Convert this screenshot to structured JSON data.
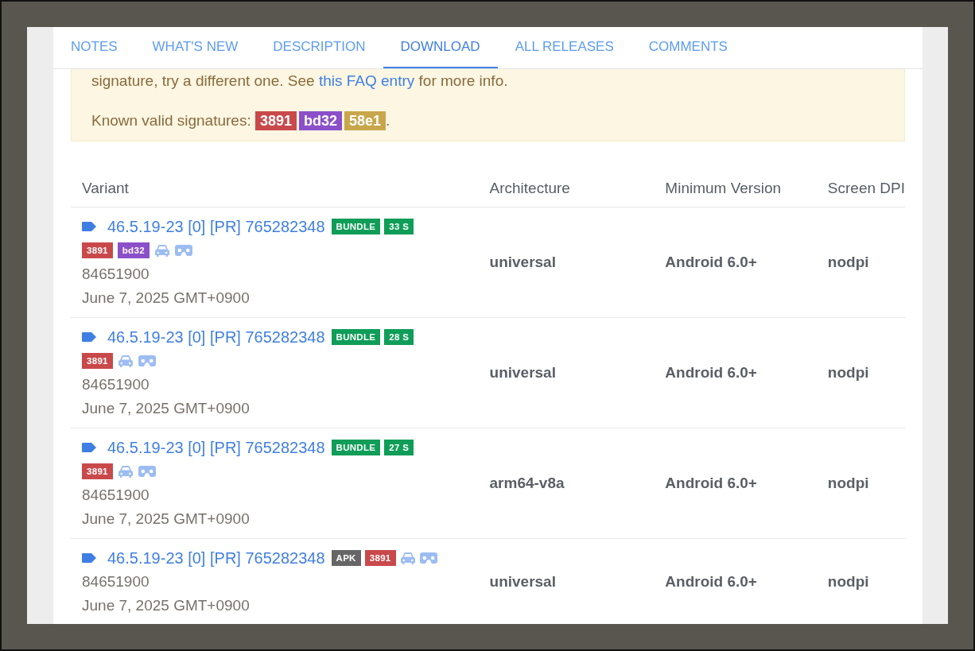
{
  "tabs": [
    {
      "label": "NOTES",
      "selected": false
    },
    {
      "label": "WHAT'S NEW",
      "selected": false
    },
    {
      "label": "DESCRIPTION",
      "selected": false
    },
    {
      "label": "DOWNLOAD",
      "selected": true
    },
    {
      "label": "ALL RELEASES",
      "selected": false
    },
    {
      "label": "COMMENTS",
      "selected": false
    }
  ],
  "notice": {
    "text_before": "signature, try a different one. See ",
    "link": "this FAQ entry",
    "text_after": " for more info.",
    "signatures_label": "Known valid signatures:",
    "signatures": [
      {
        "label": "3891",
        "color": "#c9494b"
      },
      {
        "label": "bd32",
        "color": "#8b4fc9"
      },
      {
        "label": "58e1",
        "color": "#c8a64b"
      }
    ],
    "end": "."
  },
  "table": {
    "columns": [
      "Variant",
      "Architecture",
      "Minimum Version",
      "Screen DPI"
    ],
    "rows": [
      {
        "title": "46.5.19-23 [0] [PR] 765282348",
        "title_tags": [
          {
            "kind": "badge",
            "label": "BUNDLE",
            "color": "#0f9d58"
          },
          {
            "kind": "badge",
            "label": "33 S",
            "color": "#0f9d58"
          }
        ],
        "line_tags": [
          {
            "kind": "badge",
            "label": "3891",
            "color": "#c9494b"
          },
          {
            "kind": "badge",
            "label": "bd32",
            "color": "#8b4fc9"
          },
          {
            "kind": "car"
          },
          {
            "kind": "vr"
          }
        ],
        "version_code": "84651900",
        "date": "June 7, 2025 GMT+0900",
        "architecture": "universal",
        "min_version": "Android 6.0+",
        "dpi": "nodpi"
      },
      {
        "title": "46.5.19-23 [0] [PR] 765282348",
        "title_tags": [
          {
            "kind": "badge",
            "label": "BUNDLE",
            "color": "#0f9d58"
          },
          {
            "kind": "badge",
            "label": "28 S",
            "color": "#0f9d58"
          }
        ],
        "line_tags": [
          {
            "kind": "badge",
            "label": "3891",
            "color": "#c9494b"
          },
          {
            "kind": "car"
          },
          {
            "kind": "vr"
          }
        ],
        "version_code": "84651900",
        "date": "June 7, 2025 GMT+0900",
        "architecture": "universal",
        "min_version": "Android 6.0+",
        "dpi": "nodpi"
      },
      {
        "title": "46.5.19-23 [0] [PR] 765282348",
        "title_tags": [
          {
            "kind": "badge",
            "label": "BUNDLE",
            "color": "#0f9d58"
          },
          {
            "kind": "badge",
            "label": "27 S",
            "color": "#0f9d58"
          }
        ],
        "line_tags": [
          {
            "kind": "badge",
            "label": "3891",
            "color": "#c9494b"
          },
          {
            "kind": "car"
          },
          {
            "kind": "vr"
          }
        ],
        "version_code": "84651900",
        "date": "June 7, 2025 GMT+0900",
        "architecture": "arm64-v8a",
        "min_version": "Android 6.0+",
        "dpi": "nodpi"
      },
      {
        "title": "46.5.19-23 [0] [PR] 765282348",
        "title_tags": [
          {
            "kind": "badge",
            "label": "APK",
            "color": "#666666"
          },
          {
            "kind": "badge",
            "label": "3891",
            "color": "#c9494b"
          },
          {
            "kind": "car"
          },
          {
            "kind": "vr"
          }
        ],
        "line_tags": [],
        "version_code": "84651900",
        "date": "June 7, 2025 GMT+0900",
        "architecture": "universal",
        "min_version": "Android 6.0+",
        "dpi": "nodpi"
      }
    ]
  }
}
